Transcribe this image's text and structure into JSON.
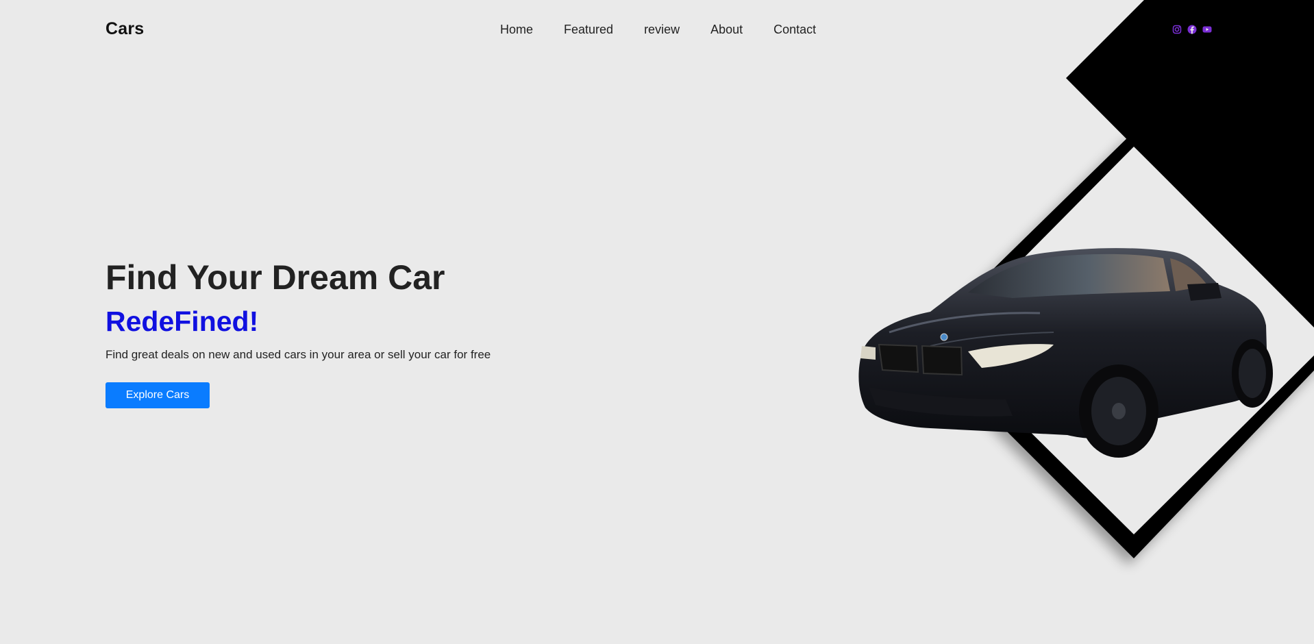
{
  "header": {
    "logo": "Cars",
    "nav": [
      "Home",
      "Featured",
      "review",
      "About",
      "Contact"
    ],
    "social_icons": [
      "instagram-icon",
      "facebook-icon",
      "youtube-icon"
    ],
    "social_color": "#7b2fd6"
  },
  "hero": {
    "title": "Find Your Dream Car",
    "subtitle": "RedeFined!",
    "subtitle_color": "#1010e0",
    "description": "Find great deals on new and used cars in your area or sell your car for free",
    "cta_label": "Explore Cars",
    "cta_color": "#0a7cff"
  },
  "colors": {
    "background": "#eaeaea",
    "decor": "#000000"
  }
}
